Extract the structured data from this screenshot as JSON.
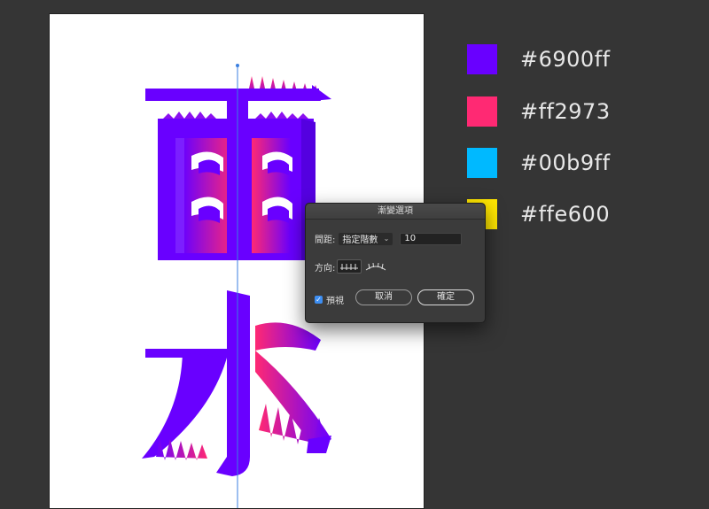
{
  "swatches": [
    {
      "hex": "#6900ff",
      "color": "#6900ff"
    },
    {
      "hex": "#ff2973",
      "color": "#ff2973"
    },
    {
      "hex": "#00b9ff",
      "color": "#00b9ff"
    },
    {
      "hex": "#ffe600",
      "color": "#ffe600"
    }
  ],
  "dialog": {
    "title": "漸變選項",
    "spacing_label": "間距:",
    "spacing_value": "指定階數",
    "steps_value": "10",
    "orientation_label": "方向:",
    "preview_label": "預視",
    "preview_checked": true,
    "cancel_label": "取消",
    "ok_label": "確定"
  },
  "artwork": {
    "characters": [
      "雨",
      "水"
    ],
    "gradient_start": "#6900ff",
    "gradient_end": "#ff2973"
  }
}
